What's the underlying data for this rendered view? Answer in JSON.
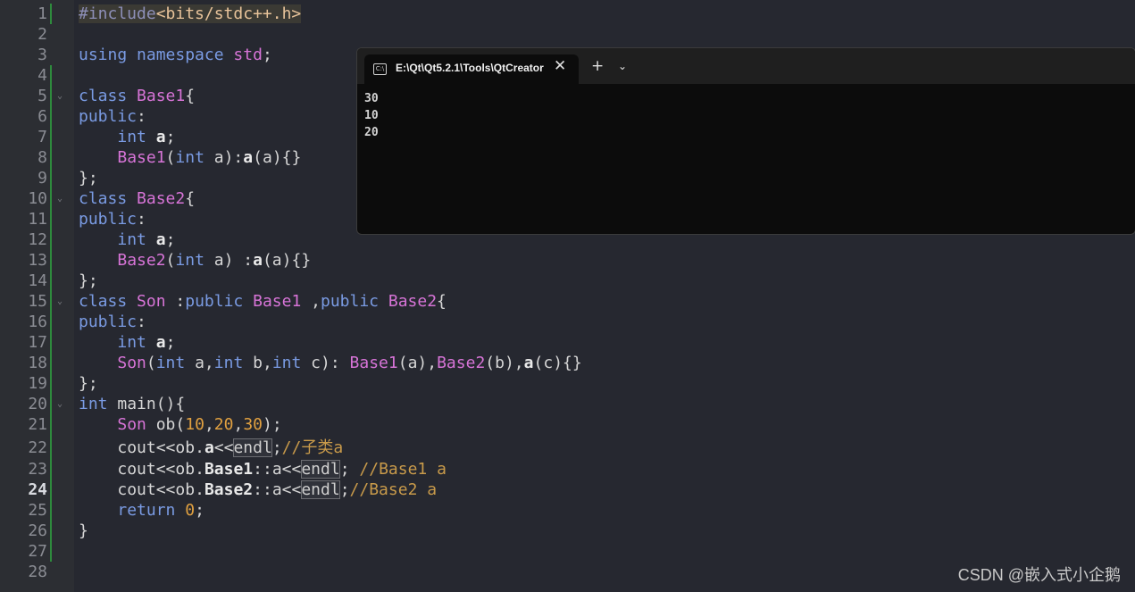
{
  "line_numbers": [
    "1",
    "2",
    "3",
    "4",
    "5",
    "6",
    "7",
    "8",
    "9",
    "10",
    "11",
    "12",
    "13",
    "14",
    "15",
    "16",
    "17",
    "18",
    "19",
    "20",
    "21",
    "22",
    "23",
    "24",
    "25",
    "26",
    "27",
    "28"
  ],
  "current_line": "24",
  "code": {
    "l1_pp": "#include",
    "l1_hdr": "<bits/stdc++.h>",
    "l3_kw1": "using",
    "l3_kw2": "namespace",
    "l3_ns": "std",
    "semi": ";",
    "kw_class": "class",
    "kw_public": "public",
    "kw_int": "int",
    "kw_return": "return",
    "base1": "Base1",
    "base2": "Base2",
    "son": "Son",
    "var_a": "a",
    "var_b": "b",
    "var_c": "c",
    "main": "main",
    "ob": "ob",
    "cout": "cout",
    "endl": "endl",
    "num_10": "10",
    "num_20": "20",
    "num_30": "30",
    "num_0": "0",
    "cmt_22": "//子类a",
    "cmt_23": "//Base1 a",
    "cmt_24": "//Base2 a"
  },
  "terminal": {
    "tab_title": "E:\\Qt\\Qt5.2.1\\Tools\\QtCreator",
    "tab_icon_glyph": "C:\\",
    "close_glyph": "✕",
    "plus_glyph": "+",
    "chevron_glyph": "⌄",
    "output": [
      "30",
      "10",
      "20"
    ]
  },
  "watermark": "CSDN @嵌入式小企鹅",
  "colors": {
    "editor_bg": "#262830",
    "terminal_bg": "#0c0c0c",
    "keyword": "#7a9be3",
    "type": "#d774d7",
    "number": "#e0a040",
    "comment": "#c89a4a"
  }
}
